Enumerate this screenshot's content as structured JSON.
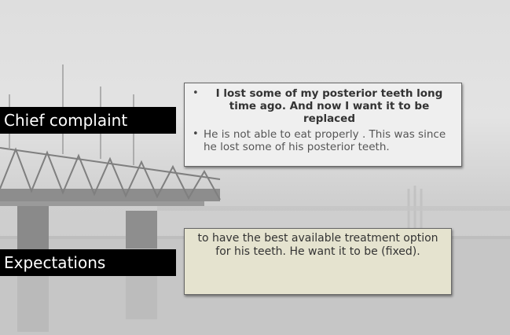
{
  "slide": {
    "chief_label": "Chief complaint",
    "chief_items": [
      "I lost some of my posterior teeth long time ago. And now I want it to be replaced",
      "He is not able to eat properly . This was since he lost some of his posterior teeth."
    ],
    "expect_label": "Expectations",
    "expect_text": "to have the best available treatment option for his teeth. He want it to be (fixed).",
    "bullet_glyph": "•",
    "colors": {
      "label_bg": "#000000",
      "chief_box_bg": "#efefef",
      "expect_box_bg": "#e5e3cf"
    }
  }
}
